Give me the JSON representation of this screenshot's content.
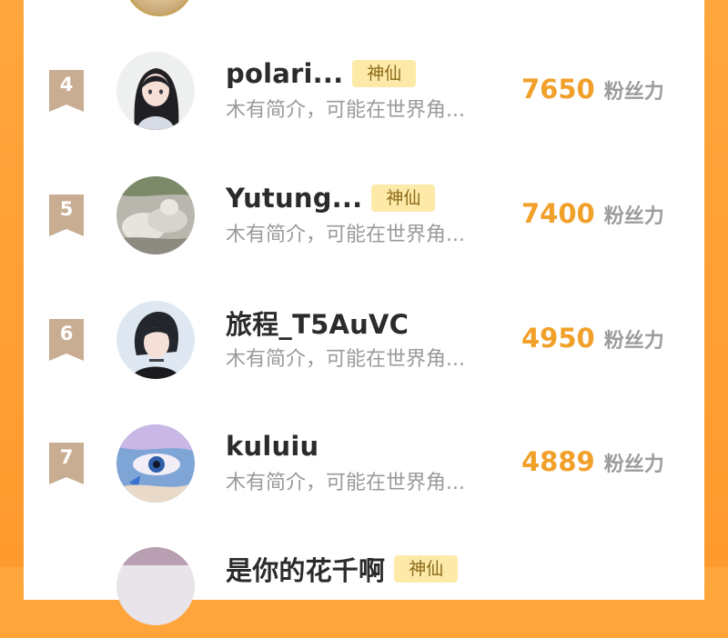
{
  "fans_label": "粉丝力",
  "colors": {
    "background": "#ff9a2e",
    "panel": "#ffffff",
    "rank_badge": "#c9ad93",
    "title_badge_bg": "#fde9a8",
    "title_badge_text": "#8a6a18",
    "fans_number": "#f1a02a"
  },
  "rows": [
    {
      "rank": "4",
      "name": "polari...",
      "badge": "神仙",
      "bio": "木有简介，可能在世界角...",
      "fans": "7650",
      "avatar": "girl-with-black-hair-avatar"
    },
    {
      "rank": "5",
      "name": "Yutung...",
      "badge": "神仙",
      "bio": "木有简介，可能在世界角...",
      "fans": "7400",
      "avatar": "sleeping-cats-avatar"
    },
    {
      "rank": "6",
      "name": "旅程_T5AuVC",
      "badge": "",
      "bio": "木有简介，可能在世界角...",
      "fans": "4950",
      "avatar": "boy-with-choker-avatar"
    },
    {
      "rank": "7",
      "name": "kuluiu",
      "badge": "",
      "bio": "木有简介，可能在世界角...",
      "fans": "4889",
      "avatar": "blue-eye-butterfly-avatar"
    },
    {
      "rank": "",
      "name": "是你的花千啊",
      "badge": "神仙",
      "bio": "",
      "fans": "",
      "avatar": "partial-avatar"
    }
  ]
}
